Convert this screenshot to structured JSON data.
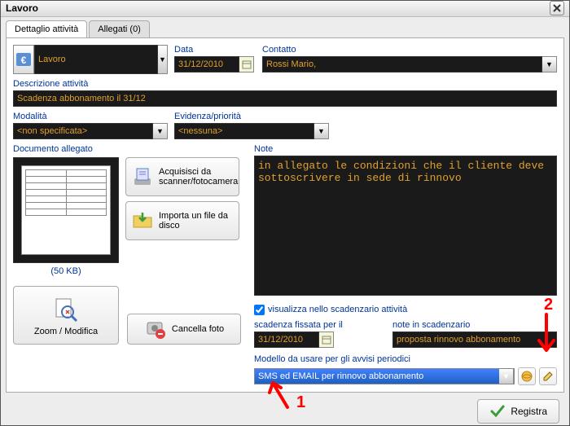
{
  "window": {
    "title": "Lavoro"
  },
  "tabs": {
    "detail": "Dettaglio attività",
    "attachments": "Allegati (0)"
  },
  "top": {
    "type_value": "Lavoro",
    "date_label": "Data",
    "date_value": "31/12/2010",
    "contact_label": "Contatto",
    "contact_value": "Rossi Mario,"
  },
  "desc": {
    "label": "Descrizione attività",
    "value": "Scadenza abbonamento il 31/12"
  },
  "mode": {
    "label": "Modalità",
    "value": "<non specificata>"
  },
  "priority": {
    "label": "Evidenza/priorità",
    "value": "<nessuna>"
  },
  "doc": {
    "label": "Documento allegato",
    "filesize": "(50 KB)",
    "scan_btn": "Acquisisci da scanner/fotocamera",
    "import_btn": "Importa un file da disco",
    "zoom_btn": "Zoom / Modifica",
    "cancel_btn": "Cancella foto"
  },
  "note": {
    "label": "Note",
    "value": "in allegato le condizioni che il cliente deve sottoscrivere in sede di rinnovo"
  },
  "sched": {
    "checkbox": "visualizza nello scadenzario attività",
    "fixed_label": "scadenza fissata per il",
    "fixed_value": "31/12/2010",
    "note_label": "note in scadenzario",
    "note_value": "proposta rinnovo abbonamento",
    "model_label": "Modello da usare per gli avvisi periodici",
    "model_value": "SMS ed EMAIL per rinnovo abbonamento"
  },
  "footer": {
    "register": "Registra"
  },
  "callouts": {
    "one": "1",
    "two": "2"
  }
}
